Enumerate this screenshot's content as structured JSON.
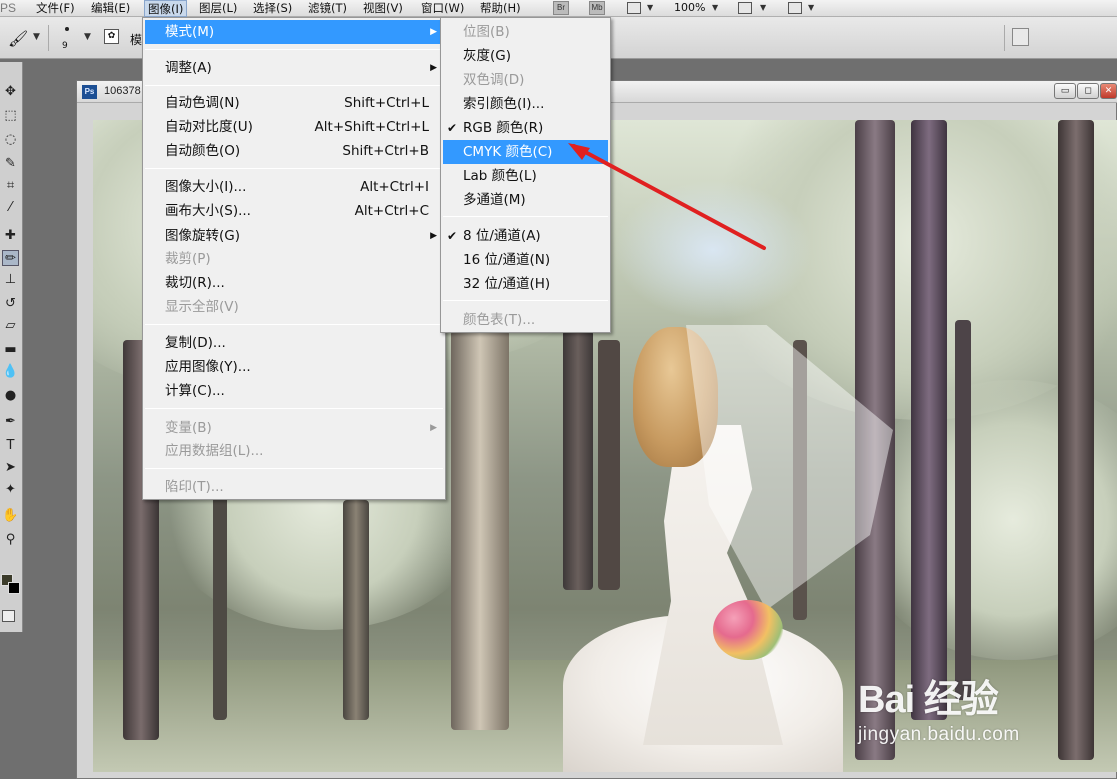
{
  "app": {
    "logo": "PS"
  },
  "menubar": {
    "items": [
      "文件(F)",
      "编辑(E)",
      "图像(I)",
      "图层(L)",
      "选择(S)",
      "滤镜(T)",
      "视图(V)",
      "窗口(W)",
      "帮助(H)"
    ],
    "bridge_label": "Br",
    "minibridge_label": "Mb",
    "zoom": "100%"
  },
  "optbar": {
    "brush_size": "9",
    "mode_label": "模"
  },
  "document": {
    "title_prefix": "106378",
    "ps_icon": "Ps"
  },
  "image_menu": {
    "items": [
      {
        "label": "模式(M)",
        "submenu": true,
        "highlight": true
      },
      {
        "label": "调整(A)",
        "submenu": true
      },
      {
        "label": "自动色调(N)",
        "shortcut": "Shift+Ctrl+L"
      },
      {
        "label": "自动对比度(U)",
        "shortcut": "Alt+Shift+Ctrl+L"
      },
      {
        "label": "自动颜色(O)",
        "shortcut": "Shift+Ctrl+B"
      },
      {
        "label": "图像大小(I)...",
        "shortcut": "Alt+Ctrl+I"
      },
      {
        "label": "画布大小(S)...",
        "shortcut": "Alt+Ctrl+C"
      },
      {
        "label": "图像旋转(G)",
        "submenu": true
      },
      {
        "label": "裁剪(P)",
        "disabled": true
      },
      {
        "label": "裁切(R)..."
      },
      {
        "label": "显示全部(V)",
        "disabled": true
      },
      {
        "label": "复制(D)..."
      },
      {
        "label": "应用图像(Y)..."
      },
      {
        "label": "计算(C)..."
      },
      {
        "label": "变量(B)",
        "submenu": true,
        "disabled": true
      },
      {
        "label": "应用数据组(L)...",
        "disabled": true
      },
      {
        "label": "陷印(T)...",
        "disabled": true
      }
    ]
  },
  "mode_submenu": {
    "items": [
      {
        "label": "位图(B)",
        "disabled": true
      },
      {
        "label": "灰度(G)"
      },
      {
        "label": "双色调(D)",
        "disabled": true
      },
      {
        "label": "索引颜色(I)..."
      },
      {
        "label": "RGB 颜色(R)",
        "checked": true
      },
      {
        "label": "CMYK 颜色(C)",
        "highlight": true
      },
      {
        "label": "Lab 颜色(L)"
      },
      {
        "label": "多通道(M)"
      },
      {
        "label": "8 位/通道(A)",
        "checked": true
      },
      {
        "label": "16 位/通道(N)"
      },
      {
        "label": "32 位/通道(H)"
      },
      {
        "label": "颜色表(T)...",
        "disabled": true
      }
    ]
  },
  "watermark": {
    "big": "Bai 经验",
    "small": "jingyan.baidu.com"
  },
  "colors": {
    "highlight": "#3399ff",
    "annotation_arrow": "#e02020"
  }
}
